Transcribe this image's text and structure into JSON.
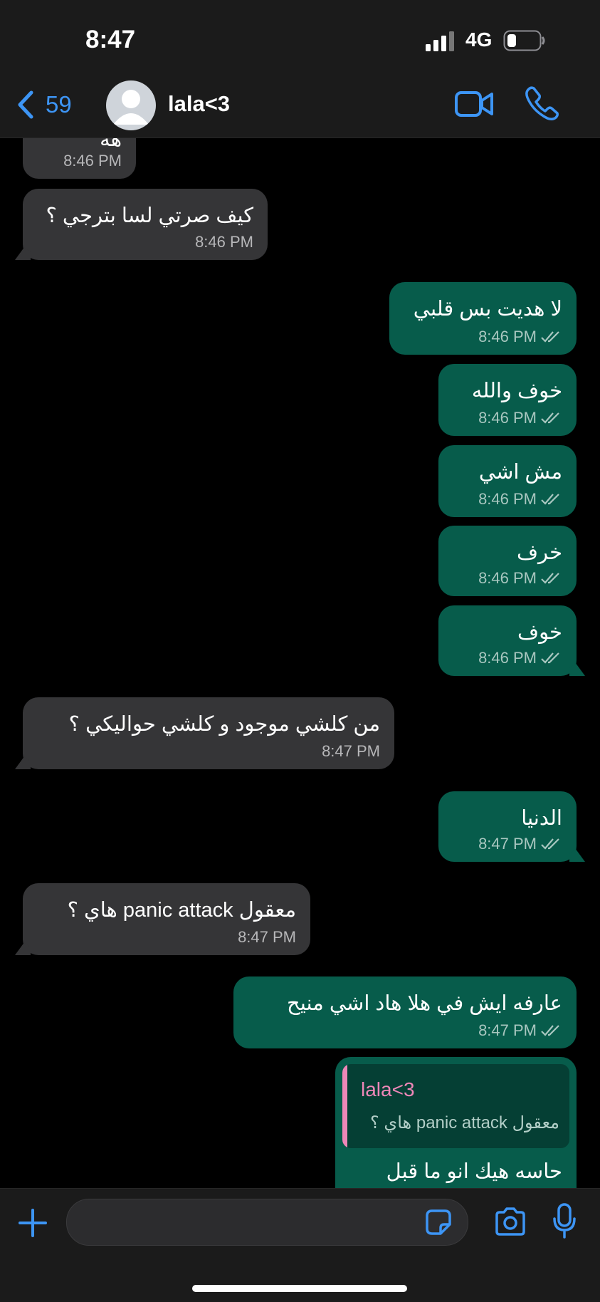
{
  "status": {
    "time": "8:47",
    "network": "4G"
  },
  "nav": {
    "back_count": "59",
    "contact_name": "lala<3"
  },
  "messages": [
    {
      "dir": "in",
      "text": "هه",
      "time": "8:46 PM"
    },
    {
      "dir": "in",
      "text": "كيف صرتي لسا بترجي ؟",
      "time": "8:46 PM"
    },
    {
      "dir": "out",
      "text": "لا هديت بس قلبي",
      "time": "8:46 PM"
    },
    {
      "dir": "out",
      "text": "خوف والله",
      "time": "8:46 PM"
    },
    {
      "dir": "out",
      "text": "مش اشي",
      "time": "8:46 PM"
    },
    {
      "dir": "out",
      "text": "خرف",
      "time": "8:46 PM"
    },
    {
      "dir": "out",
      "text": "خوف",
      "time": "8:46 PM"
    },
    {
      "dir": "in",
      "text": "من كلشي موجود و كلشي حواليكي ؟",
      "time": "8:47 PM"
    },
    {
      "dir": "out",
      "text": "الدنيا",
      "time": "8:47 PM"
    },
    {
      "dir": "in",
      "text": "معقول panic attack هاي ؟",
      "time": "8:47 PM"
    },
    {
      "dir": "out",
      "text": "عارفه ايش في هلا هاد اشي منيح",
      "time": "8:47 PM"
    },
    {
      "dir": "out",
      "text": "حاسه هيك انو ما قبل",
      "reply": {
        "name": "lala<3",
        "text": "معقول panic attack هاي ؟"
      }
    }
  ],
  "input": {
    "placeholder": ""
  },
  "colors": {
    "incoming": "#353537",
    "outgoing": "#075c4b",
    "accent": "#3d95f5",
    "reply_name": "#ee87b8"
  }
}
